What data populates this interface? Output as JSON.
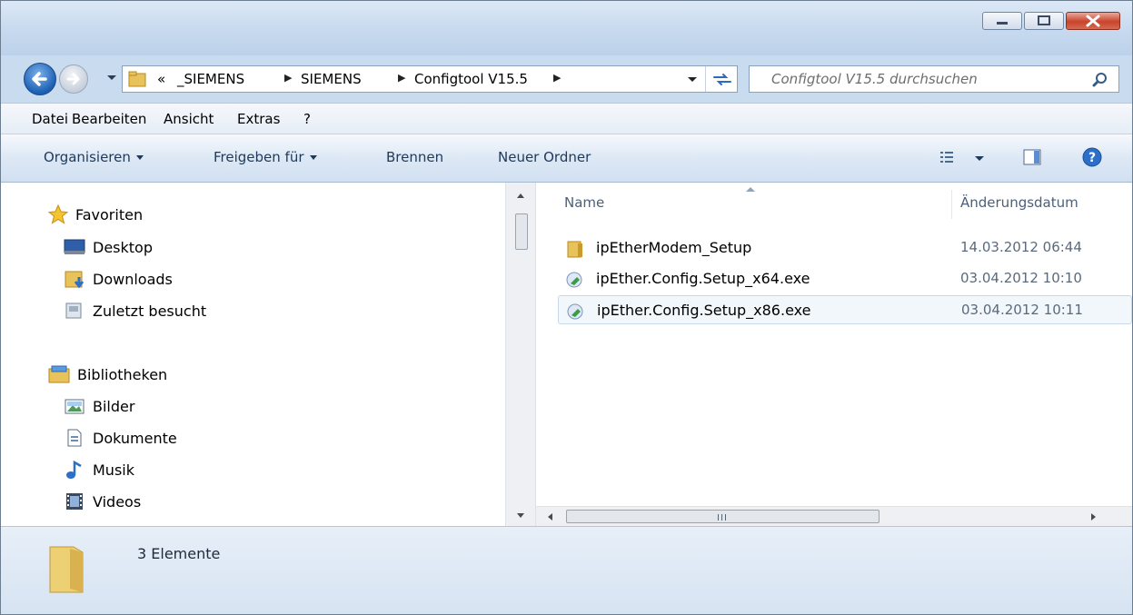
{
  "breadcrumb": {
    "overflow": "«",
    "items": [
      "_SIEMENS",
      "SIEMENS",
      "Configtool V15.5"
    ]
  },
  "search": {
    "placeholder": "Configtool V15.5 durchsuchen"
  },
  "menu": [
    "Datei",
    "Bearbeiten",
    "Ansicht",
    "Extras",
    "?"
  ],
  "toolbar": {
    "organize": "Organisieren",
    "share": "Freigeben für",
    "burn": "Brennen",
    "new_folder": "Neuer Ordner"
  },
  "nav": {
    "favorites_label": "Favoriten",
    "favorites": [
      "Desktop",
      "Downloads",
      "Zuletzt besucht"
    ],
    "libraries_label": "Bibliotheken",
    "libraries": [
      "Bilder",
      "Dokumente",
      "Musik",
      "Videos"
    ]
  },
  "files": {
    "columns": [
      "Name",
      "Änderungsdatum"
    ],
    "rows": [
      {
        "name": "ipEtherModem_Setup",
        "date": "14.03.2012 06:44",
        "type": "folder"
      },
      {
        "name": "ipEther.Config.Setup_x64.exe",
        "date": "03.04.2012 10:10",
        "type": "installer"
      },
      {
        "name": "ipEther.Config.Setup_x86.exe",
        "date": "03.04.2012 10:11",
        "type": "installer"
      }
    ]
  },
  "details": {
    "count": "3 Elemente"
  },
  "colors": {
    "window_frame": "#c9dbee",
    "command_text": "#1e395b",
    "selection": "#f2f7fc"
  }
}
